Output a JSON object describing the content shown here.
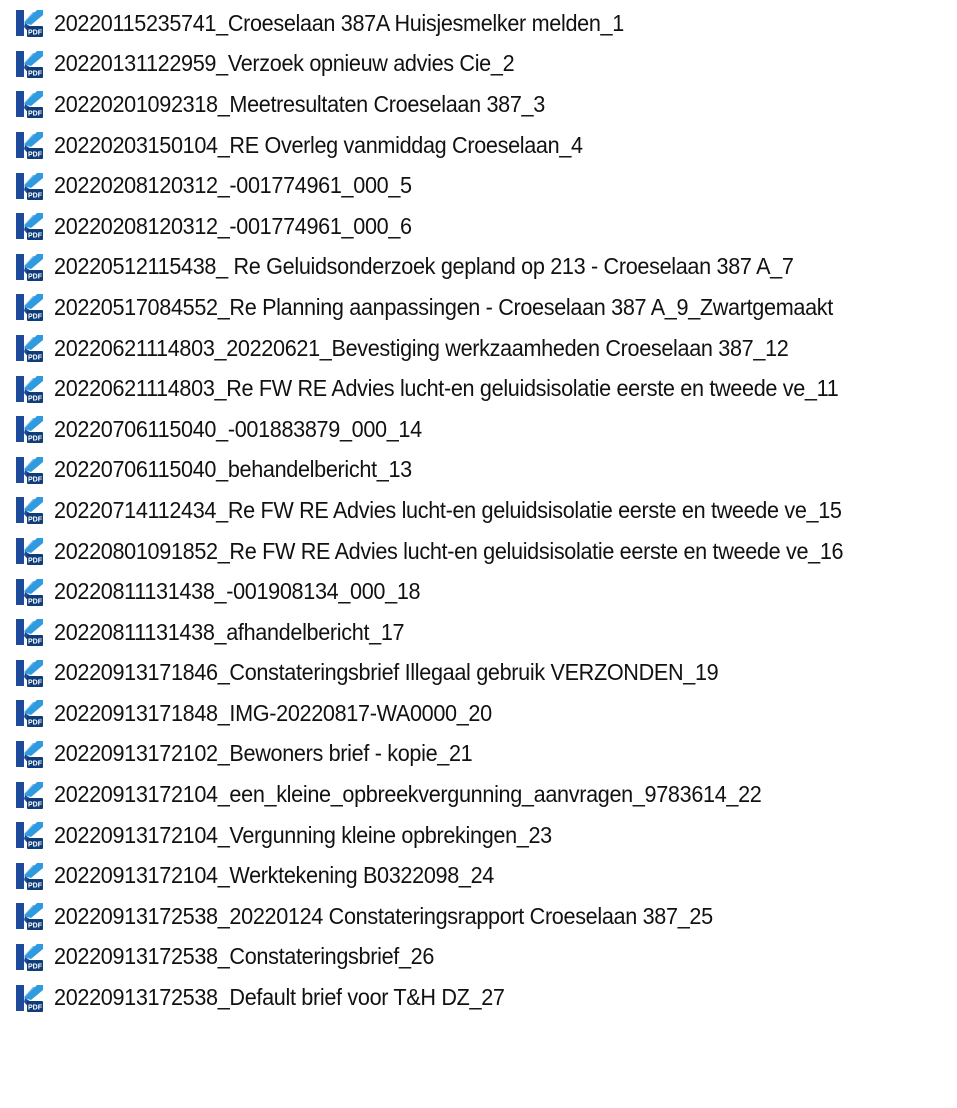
{
  "file_list": {
    "icon": "pdf-document-icon",
    "icon_badge_text": "PDF",
    "colors": {
      "icon_dark_blue": "#1d4a9a",
      "icon_light_blue": "#2f9ae0",
      "icon_badge_bg": "#0f3d7a",
      "text": "#111111",
      "background": "#ffffff"
    },
    "items": [
      {
        "name": "20220115235741_Croeselaan 387A  Huisjesmelker melden_1"
      },
      {
        "name": "20220131122959_Verzoek opnieuw advies Cie_2"
      },
      {
        "name": "20220201092318_Meetresultaten Croeselaan 387_3"
      },
      {
        "name": "20220203150104_RE Overleg vanmiddag Croeselaan_4"
      },
      {
        "name": "20220208120312_-001774961_000_5"
      },
      {
        "name": "20220208120312_-001774961_000_6"
      },
      {
        "name": "20220512115438_ Re Geluidsonderzoek gepland op 213 - Croeselaan 387 A_7"
      },
      {
        "name": "20220517084552_Re Planning aanpassingen - Croeselaan 387 A_9_Zwartgemaakt"
      },
      {
        "name": "20220621114803_20220621_Bevestiging werkzaamheden Croeselaan 387_12"
      },
      {
        "name": "20220621114803_Re FW RE Advies lucht-en geluidsisolatie eerste en tweede ve_11"
      },
      {
        "name": "20220706115040_-001883879_000_14"
      },
      {
        "name": "20220706115040_behandelbericht_13"
      },
      {
        "name": "20220714112434_Re FW RE Advies lucht-en geluidsisolatie eerste en tweede ve_15"
      },
      {
        "name": "20220801091852_Re FW RE Advies lucht-en geluidsisolatie eerste en tweede ve_16"
      },
      {
        "name": "20220811131438_-001908134_000_18"
      },
      {
        "name": "20220811131438_afhandelbericht_17"
      },
      {
        "name": "20220913171846_Constateringsbrief Illegaal gebruik  VERZONDEN_19"
      },
      {
        "name": "20220913171848_IMG-20220817-WA0000_20"
      },
      {
        "name": "20220913172102_Bewoners brief - kopie_21"
      },
      {
        "name": "20220913172104_een_kleine_opbreekvergunning_aanvragen_9783614_22"
      },
      {
        "name": "20220913172104_Vergunning kleine opbrekingen_23"
      },
      {
        "name": "20220913172104_Werktekening B0322098_24"
      },
      {
        "name": "20220913172538_20220124 Constateringsrapport Croeselaan 387_25"
      },
      {
        "name": "20220913172538_Constateringsbrief_26"
      },
      {
        "name": "20220913172538_Default brief voor T&H DZ_27"
      }
    ]
  }
}
